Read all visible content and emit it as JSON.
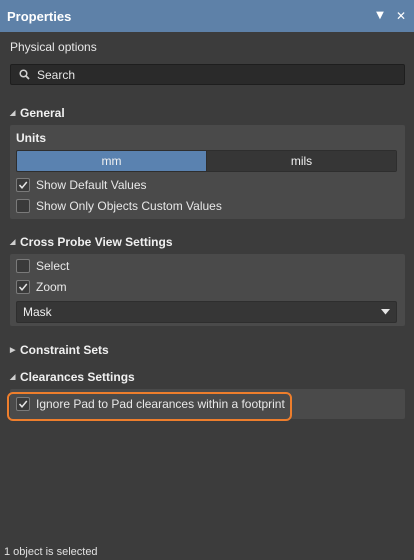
{
  "window": {
    "title": "Properties",
    "buttons": {
      "pin": "▼",
      "close": "✕"
    }
  },
  "panel": {
    "subtitle": "Physical options",
    "search": {
      "placeholder": "Search",
      "value": ""
    }
  },
  "sections": {
    "general": {
      "title": "General",
      "units_label": "Units",
      "units_options": [
        "mm",
        "mils"
      ],
      "units_selected": "mm",
      "show_default_values": {
        "label": "Show Default Values",
        "checked": true
      },
      "show_only_custom": {
        "label": "Show Only Objects Custom Values",
        "checked": false
      }
    },
    "cross_probe": {
      "title": "Cross Probe View Settings",
      "select": {
        "label": "Select",
        "checked": false
      },
      "zoom": {
        "label": "Zoom",
        "checked": true
      },
      "mode": {
        "value": "Mask"
      }
    },
    "constraint_sets": {
      "title": "Constraint Sets",
      "expanded": false
    },
    "clearances": {
      "title": "Clearances Settings",
      "ignore_pad": {
        "label": "Ignore Pad to Pad clearances within a footprint",
        "checked": true
      }
    }
  },
  "status_bar": {
    "text": "1 object is selected"
  },
  "colors": {
    "title_bar": "#5e81a8",
    "accent_selected": "#5a82b0",
    "highlight": "#ee7e2c",
    "panel": "#3c3c3c",
    "group": "#4a4a4a"
  },
  "icons": {
    "search": "search-icon",
    "check": "checkmark-icon",
    "dropdown": "chevron-down-icon",
    "expanded": "triangle-expanded-icon",
    "collapsed": "triangle-collapsed-icon"
  }
}
